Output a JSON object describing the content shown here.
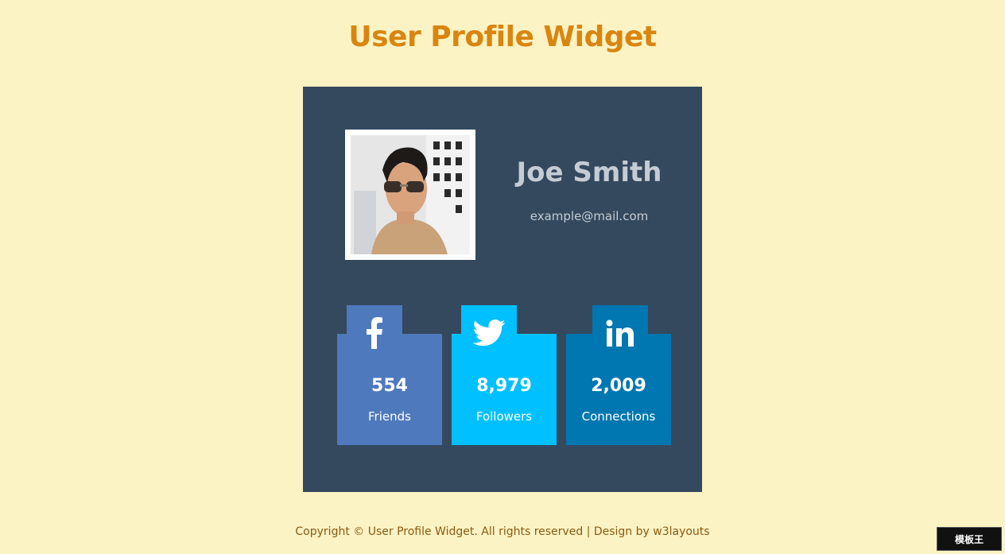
{
  "page": {
    "title": "User Profile Widget",
    "background_color": "#fbf3c4",
    "title_color": "#d98510"
  },
  "profile": {
    "name": "Joe Smith",
    "email": "example@mail.com",
    "avatar_icon": "user-photo",
    "card_color": "#34495e"
  },
  "social": [
    {
      "network": "facebook",
      "icon": "facebook-icon",
      "count": "554",
      "label": "Friends",
      "color": "#4e79bd"
    },
    {
      "network": "twitter",
      "icon": "twitter-icon",
      "count": "8,979",
      "label": "Followers",
      "color": "#00c0ff"
    },
    {
      "network": "linkedin",
      "icon": "linkedin-icon",
      "count": "2,009",
      "label": "Connections",
      "color": "#0077b0"
    }
  ],
  "footer": {
    "text": "Copyright © User Profile Widget. All rights reserved | Design by w3layouts"
  },
  "watermark": {
    "text": "模板王"
  }
}
